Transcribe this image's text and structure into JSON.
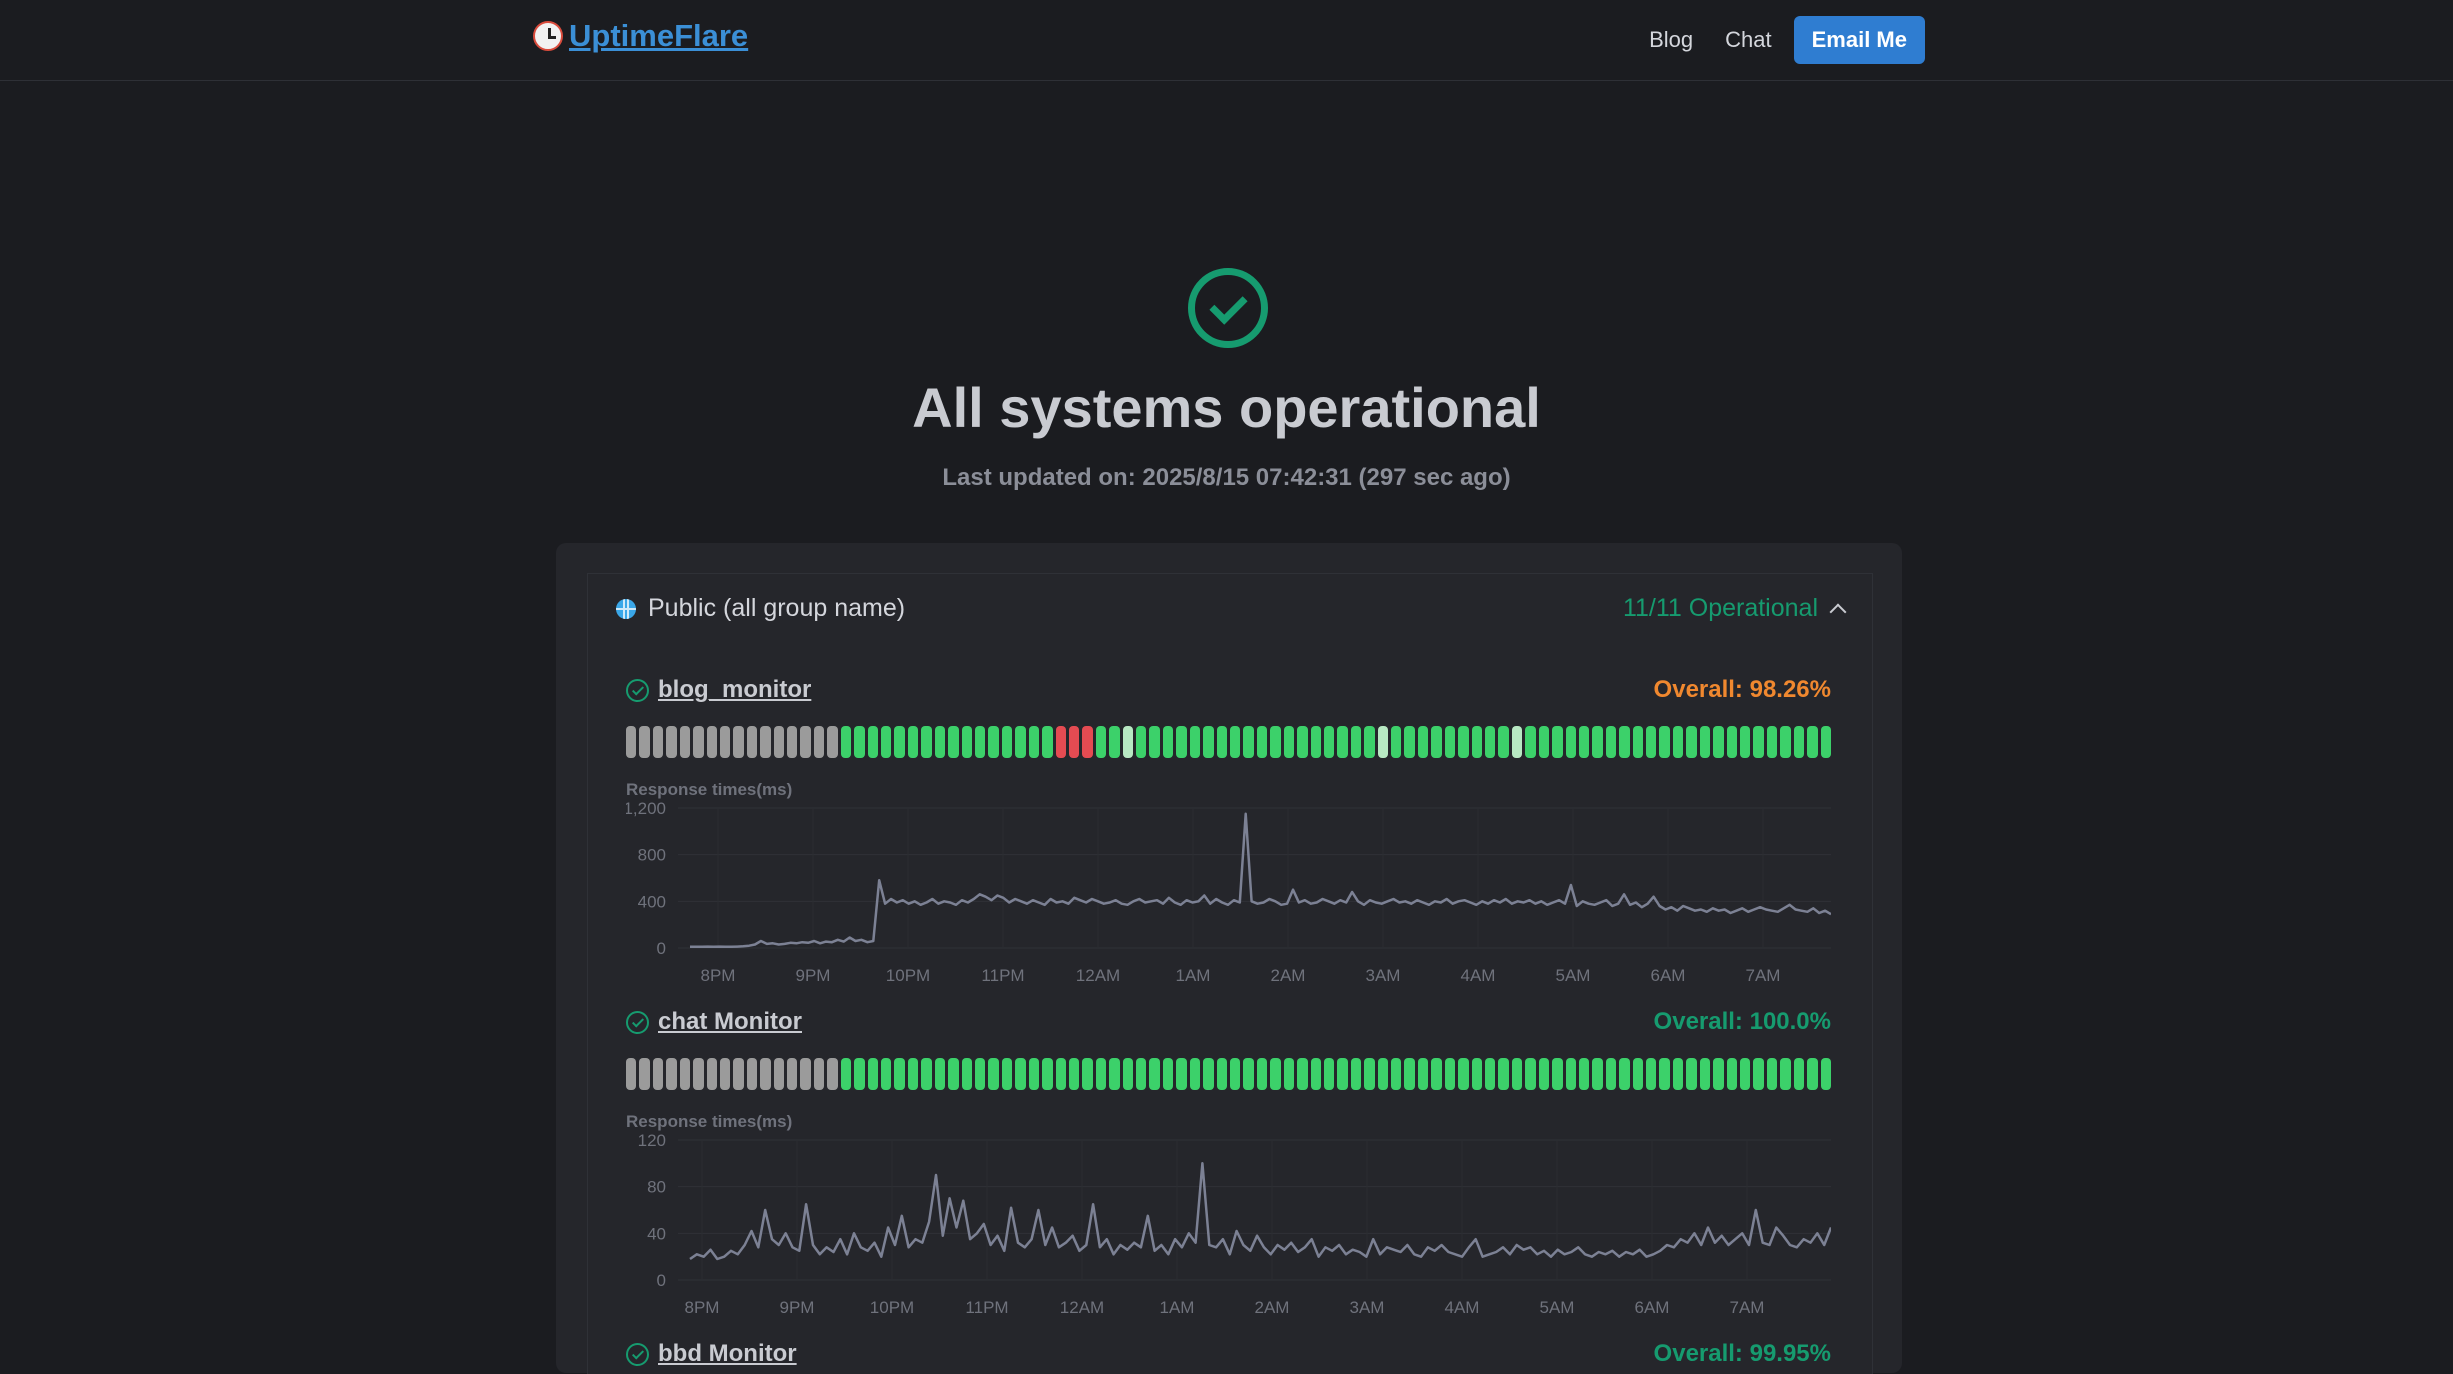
{
  "header": {
    "brand": "UptimeFlare",
    "nav": [
      {
        "label": "Blog"
      },
      {
        "label": "Chat"
      }
    ],
    "email_button": "Email Me"
  },
  "hero": {
    "status_title": "All systems operational",
    "last_updated": "Last updated on: 2025/8/15 07:42:31 (297 sec ago)"
  },
  "group": {
    "name": "Public (all group name)",
    "status": "11/11 Operational"
  },
  "colors": {
    "operational": "#169b6f",
    "warning": "#f0882f",
    "bar_up": "#3cd16a",
    "bar_down": "#e54b52",
    "bar_nodata": "#9b9b9b",
    "line": "#7c8194"
  },
  "monitors": [
    {
      "name": "blog_monitor",
      "overall": "Overall: 98.26%",
      "overall_color": "#f0882f",
      "bars": "ggggggggggggggggrrrgglgggggggggggggggggglggggggggglggggggggggggggggggggggggggggggggggggggggrg",
      "bar_counts": {
        "nodata": 16,
        "total": 90
      },
      "chart_label": "Response times(ms)",
      "chart_data": {
        "type": "line",
        "title": "",
        "ylabel": "Response times(ms)",
        "ylim": [
          0,
          1200
        ],
        "yticks": [
          "1,200",
          "800",
          "400",
          "0"
        ],
        "xticks": [
          "8PM",
          "9PM",
          "10PM",
          "11PM",
          "12AM",
          "1AM",
          "2AM",
          "3AM",
          "4AM",
          "5AM",
          "6AM",
          "7AM"
        ],
        "values": [
          10,
          10,
          10,
          12,
          10,
          12,
          11,
          10,
          12,
          15,
          20,
          30,
          60,
          35,
          40,
          30,
          35,
          45,
          40,
          50,
          45,
          60,
          40,
          55,
          50,
          70,
          55,
          90,
          60,
          70,
          50,
          60,
          580,
          380,
          420,
          390,
          410,
          380,
          400,
          370,
          390,
          420,
          380,
          400,
          390,
          370,
          410,
          390,
          420,
          460,
          440,
          410,
          450,
          430,
          390,
          420,
          400,
          380,
          410,
          390,
          370,
          420,
          390,
          400,
          380,
          430,
          410,
          390,
          420,
          400,
          380,
          390,
          410,
          380,
          370,
          400,
          420,
          390,
          400,
          410,
          380,
          430,
          390,
          370,
          410,
          390,
          400,
          450,
          380,
          420,
          390,
          370,
          410,
          390,
          1150,
          400,
          380,
          390,
          420,
          400,
          370,
          380,
          500,
          390,
          410,
          380,
          390,
          420,
          400,
          380,
          410,
          390,
          480,
          400,
          370,
          410,
          390,
          380,
          400,
          420,
          390,
          400,
          380,
          410,
          390,
          370,
          400,
          390,
          420,
          380,
          400,
          410,
          390,
          370,
          400,
          380,
          410,
          390,
          420,
          380,
          400,
          390,
          410,
          380,
          400,
          370,
          390,
          410,
          380,
          540,
          360,
          400,
          380,
          370,
          390,
          410,
          360,
          380,
          460,
          370,
          390,
          350,
          380,
          440,
          360,
          330,
          350,
          320,
          360,
          340,
          320,
          330,
          310,
          340,
          320,
          330,
          300,
          320,
          340,
          310,
          330,
          350,
          330,
          320,
          310,
          340,
          370,
          330,
          320,
          310,
          340,
          300,
          320,
          290
        ]
      }
    },
    {
      "name": "chat Monitor",
      "overall": "Overall: 100.0%",
      "overall_color": "#169b6f",
      "bars": "ggggggggggggggggggggggggggggggggggggggggggggggggggggggggggggggggggggggggggggggggggggggggg",
      "bar_counts": {
        "nodata": 16,
        "total": 90
      },
      "chart_label": "Response times(ms)",
      "chart_data": {
        "type": "line",
        "title": "",
        "ylabel": "Response times(ms)",
        "ylim": [
          0,
          120
        ],
        "yticks": [
          "120",
          "80",
          "40",
          "0"
        ],
        "xticks": [
          "8PM",
          "9PM",
          "10PM",
          "11PM",
          "12AM",
          "1AM",
          "2AM",
          "3AM",
          "4AM",
          "5AM",
          "6AM",
          "7AM"
        ],
        "values": [
          18,
          22,
          20,
          26,
          18,
          20,
          25,
          22,
          30,
          42,
          28,
          60,
          35,
          30,
          40,
          28,
          25,
          65,
          30,
          22,
          28,
          24,
          35,
          22,
          40,
          28,
          25,
          32,
          20,
          45,
          30,
          55,
          28,
          35,
          32,
          50,
          90,
          38,
          70,
          45,
          68,
          35,
          40,
          48,
          30,
          38,
          25,
          62,
          32,
          28,
          35,
          60,
          30,
          45,
          28,
          32,
          38,
          25,
          30,
          65,
          28,
          35,
          22,
          30,
          26,
          32,
          28,
          55,
          25,
          30,
          22,
          35,
          28,
          40,
          32,
          100,
          30,
          28,
          35,
          22,
          42,
          30,
          25,
          38,
          28,
          22,
          30,
          26,
          32,
          24,
          28,
          35,
          20,
          28,
          25,
          30,
          22,
          26,
          24,
          20,
          35,
          22,
          28,
          26,
          24,
          30,
          22,
          20,
          28,
          25,
          30,
          24,
          22,
          20,
          28,
          35,
          20,
          22,
          24,
          28,
          22,
          30,
          26,
          28,
          22,
          25,
          20,
          26,
          22,
          24,
          28,
          22,
          20,
          24,
          22,
          25,
          20,
          24,
          22,
          26,
          20,
          22,
          25,
          30,
          28,
          35,
          32,
          40,
          30,
          45,
          32,
          38,
          30,
          35,
          40,
          30,
          60,
          32,
          30,
          45,
          38,
          30,
          28,
          35,
          32,
          40,
          30,
          45
        ]
      }
    },
    {
      "name": "bbd Monitor",
      "overall": "Overall: 99.95%",
      "overall_color": "#169b6f"
    }
  ]
}
